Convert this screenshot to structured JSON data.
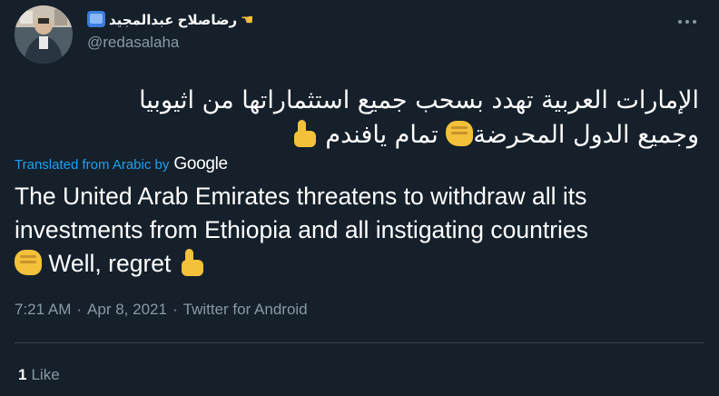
{
  "author": {
    "display_name": "رضاصلاح عبدالمجيد",
    "handle": "@redasalaha",
    "display_name_icons": [
      "tv-icon",
      "pointing-hand-icon"
    ]
  },
  "tweet": {
    "text_arabic_line1": "الإمارات العربية تهدد بسحب جميع استثماراتها من اثيوبيا",
    "text_arabic_line2a": "وجميع الدول المحرضة",
    "text_arabic_line2b": "تمام يافندم",
    "translation_label": "Translated from Arabic by",
    "translation_provider": "Google",
    "text_english_main": "The United Arab Emirates threatens to withdraw all its investments from Ethiopia and all instigating countries",
    "text_english_tail": "Well, regret",
    "time": "7:21 AM",
    "separator": "·",
    "date": "Apr 8, 2021",
    "source": "Twitter for Android"
  },
  "stats": {
    "likes_count": "1",
    "likes_label": "Like"
  },
  "colors": {
    "background": "#15202b",
    "text": "#ffffff",
    "secondary": "#8899a6",
    "link": "#1da1f2",
    "divider": "#38444d"
  }
}
